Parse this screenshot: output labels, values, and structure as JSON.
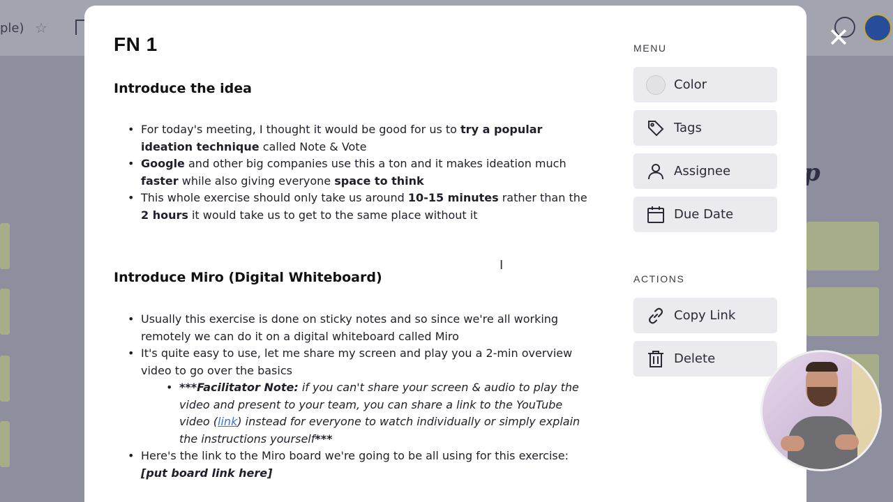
{
  "background": {
    "board_title": "ple)",
    "p_glyph": "p"
  },
  "modal": {
    "title": "FN 1",
    "sections": [
      {
        "heading": "Introduce the idea",
        "bullets_html": [
          "For today's meeting, I thought it would be good for us to <b>try a popular ideation technique</b> called Note &amp; Vote",
          "<b>Google</b> and other big companies use this a ton and it makes ideation much <b>faster</b> while also giving everyone <b>space to think</b>",
          "This whole exercise should only take us around <b>10-15 minutes</b> rather than the <b>2 hours</b> it would take us to get to the same place without it"
        ]
      },
      {
        "heading": "Introduce Miro (Digital Whiteboard)",
        "bullets_html": [
          "Usually this exercise is done on sticky notes and so since we're all working remotely we can do it on a digital whiteboard called Miro",
          "It's quite easy to use, let me share my screen and play you a 2-min overview video to go over the basics"
        ],
        "sub_bullet_html": "<b>***Facilitator Note:</b> if you can't share your screen &amp; audio to play the video and present to your team, you can share a link to the YouTube video (<span class=\"link\" data-name=\"youtube-link\" data-interactable=\"true\">link</span>) instead for everyone to watch individually or simply explain the instructions yourself<b>***</b>",
        "last_bullet_html": "Here's the link to the Miro board we're going to be all using for this exercise: <b><i>[put board link here]</i></b>"
      }
    ]
  },
  "sidebar": {
    "menu_label": "MENU",
    "menu_items": [
      {
        "label": "Color",
        "icon": "color-dot-icon"
      },
      {
        "label": "Tags",
        "icon": "tag-icon"
      },
      {
        "label": "Assignee",
        "icon": "user-icon"
      },
      {
        "label": "Due Date",
        "icon": "calendar-icon"
      }
    ],
    "actions_label": "ACTIONS",
    "action_items": [
      {
        "label": "Copy Link",
        "icon": "link-icon"
      },
      {
        "label": "Delete",
        "icon": "trash-icon"
      }
    ]
  },
  "close_glyph": "✕",
  "star_glyph": "☆",
  "cursor_glyph": "I"
}
